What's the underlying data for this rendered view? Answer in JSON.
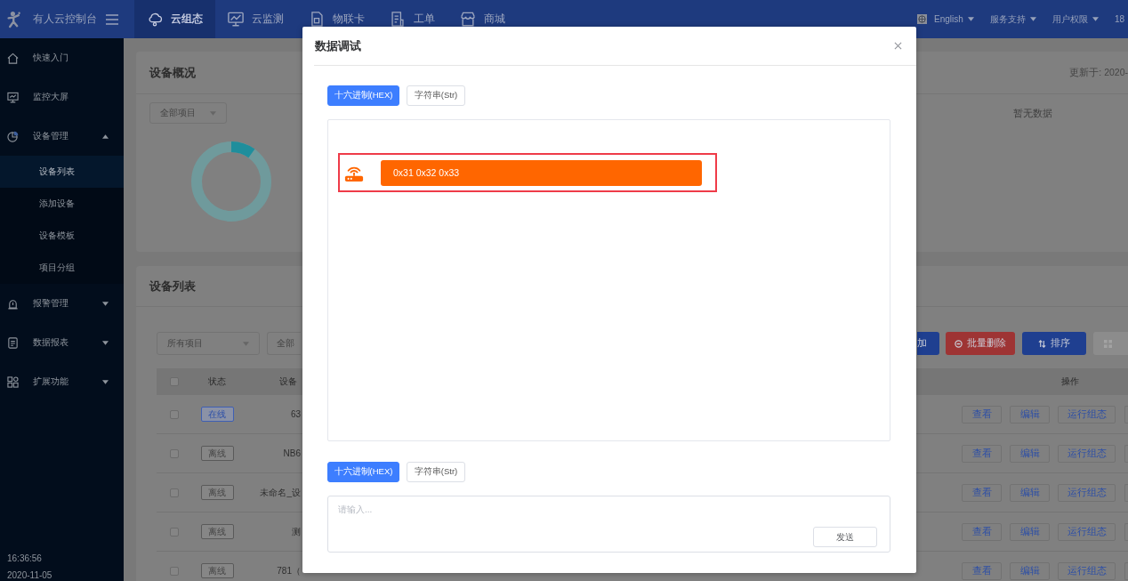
{
  "top_bar": {
    "logo": "有人云控制台",
    "nav": [
      {
        "label": "云组态",
        "selected": true
      },
      {
        "label": "云监测",
        "selected": false
      },
      {
        "label": "物联卡",
        "selected": false
      },
      {
        "label": "工单",
        "selected": false
      },
      {
        "label": "商城",
        "selected": false
      }
    ],
    "menus": [
      {
        "label": "English",
        "dropdown": true
      },
      {
        "label": "服务支持",
        "dropdown": true
      },
      {
        "label": "用户权限",
        "dropdown": true
      },
      {
        "label": "18",
        "dropdown": false
      }
    ]
  },
  "sidebar": {
    "items": [
      {
        "label": "快速入门",
        "kind": "link",
        "selected": false
      },
      {
        "label": "监控大屏",
        "kind": "link",
        "selected": false
      },
      {
        "label": "设备管理",
        "kind": "group",
        "selected": false,
        "expanded": true,
        "children": [
          {
            "label": "设备列表",
            "selected": true
          },
          {
            "label": "添加设备",
            "selected": false
          },
          {
            "label": "设备模板",
            "selected": false
          },
          {
            "label": "项目分组",
            "selected": false
          }
        ]
      },
      {
        "label": "报警管理",
        "kind": "group",
        "selected": false,
        "expanded": false
      },
      {
        "label": "数据报表",
        "kind": "group",
        "selected": false,
        "expanded": false
      },
      {
        "label": "扩展功能",
        "kind": "group",
        "selected": false,
        "expanded": false
      }
    ],
    "time": "16:36:56",
    "date": "2020-11-05"
  },
  "overview": {
    "title": "设备概况",
    "project_filter": "全部项目",
    "updated": "更新于: 2020-",
    "empty_text": "暂无数据"
  },
  "device_list": {
    "title": "设备列表",
    "filters": [
      "所有项目",
      "全部"
    ],
    "actions": [
      {
        "label": "加",
        "kind": "primary"
      },
      {
        "label": "批量删除",
        "kind": "danger"
      },
      {
        "label": "排序",
        "kind": "primary"
      },
      {
        "kind": "disabled"
      }
    ],
    "table": {
      "columns": [
        "状态",
        "设备",
        "操作"
      ],
      "all_checked": false,
      "rows": [
        {
          "checked": false,
          "status": "在线",
          "online": true,
          "name": "63",
          "actions": [
            "查看",
            "编辑",
            "运行组态"
          ]
        },
        {
          "checked": false,
          "status": "离线",
          "online": false,
          "name": "NB6",
          "actions": [
            "查看",
            "编辑",
            "运行组态"
          ]
        },
        {
          "checked": false,
          "status": "离线",
          "online": false,
          "name": "未命名_设",
          "actions": [
            "查看",
            "编辑",
            "运行组态"
          ]
        },
        {
          "checked": false,
          "status": "离线",
          "online": false,
          "name": "测",
          "actions": [
            "查看",
            "编辑",
            "运行组态"
          ]
        },
        {
          "checked": false,
          "status": "离线",
          "online": false,
          "name": "781（",
          "actions": [
            "查看",
            "编辑",
            "运行组态"
          ]
        }
      ]
    }
  },
  "dialog": {
    "title": "数据调试",
    "format_toggle": [
      {
        "label": "十六进制(HEX)",
        "selected": true
      },
      {
        "label": "字符串(Str)",
        "selected": false
      }
    ],
    "messages": [
      {
        "text": "0x31 0x32 0x33",
        "highlighted": true
      }
    ],
    "input_format_toggle": [
      {
        "label": "十六进制(HEX)",
        "selected": true
      },
      {
        "label": "字符串(Str)",
        "selected": false
      }
    ],
    "input": {
      "placeholder": "请输入..."
    },
    "send_button": "发送"
  }
}
